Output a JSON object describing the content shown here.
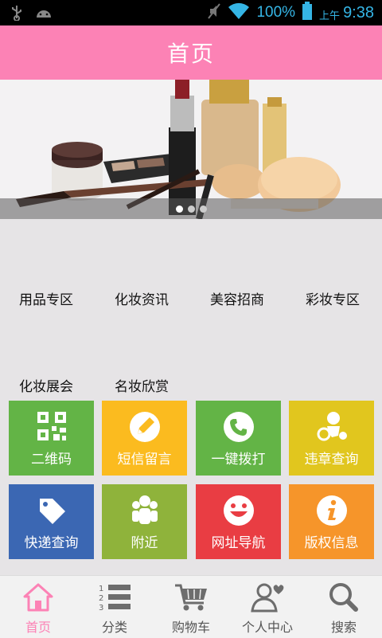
{
  "status_bar": {
    "battery_percent": "100%",
    "ampm": "上午",
    "time": "9:38",
    "icons": [
      "usb-icon",
      "android-icon",
      "mute-icon",
      "wifi-icon",
      "battery-icon"
    ]
  },
  "header": {
    "title": "首页"
  },
  "banner": {
    "pages": 3,
    "active_page": 1
  },
  "categories": [
    {
      "label": "用品专区"
    },
    {
      "label": "化妆资讯"
    },
    {
      "label": "美容招商"
    },
    {
      "label": "彩妆专区"
    },
    {
      "label": "化妆展会"
    },
    {
      "label": "名妆欣赏"
    }
  ],
  "tiles": [
    {
      "label": "二维码",
      "icon": "qr-code-icon",
      "color": "#63b446"
    },
    {
      "label": "短信留言",
      "icon": "pencil-icon",
      "color": "#fbbb1f"
    },
    {
      "label": "一键拨打",
      "icon": "phone-icon",
      "color": "#63b446"
    },
    {
      "label": "违章查询",
      "icon": "rider-icon",
      "color": "#e1c61e"
    },
    {
      "label": "快递查询",
      "icon": "tag-icon",
      "color": "#3b67b3"
    },
    {
      "label": "附近",
      "icon": "people-icon",
      "color": "#8fb33b"
    },
    {
      "label": "网址导航",
      "icon": "smiley-icon",
      "color": "#e93d43"
    },
    {
      "label": "版权信息",
      "icon": "info-icon",
      "color": "#f6952a"
    }
  ],
  "bottom_nav": [
    {
      "label": "首页",
      "icon": "home-icon",
      "active": true
    },
    {
      "label": "分类",
      "icon": "list-icon"
    },
    {
      "label": "购物车",
      "icon": "cart-icon"
    },
    {
      "label": "个人中心",
      "icon": "user-icon"
    },
    {
      "label": "搜索",
      "icon": "search-icon"
    }
  ],
  "colors": {
    "accent": "#fc82b5",
    "status_blue": "#35b5e5",
    "background": "#e6e4e6"
  }
}
